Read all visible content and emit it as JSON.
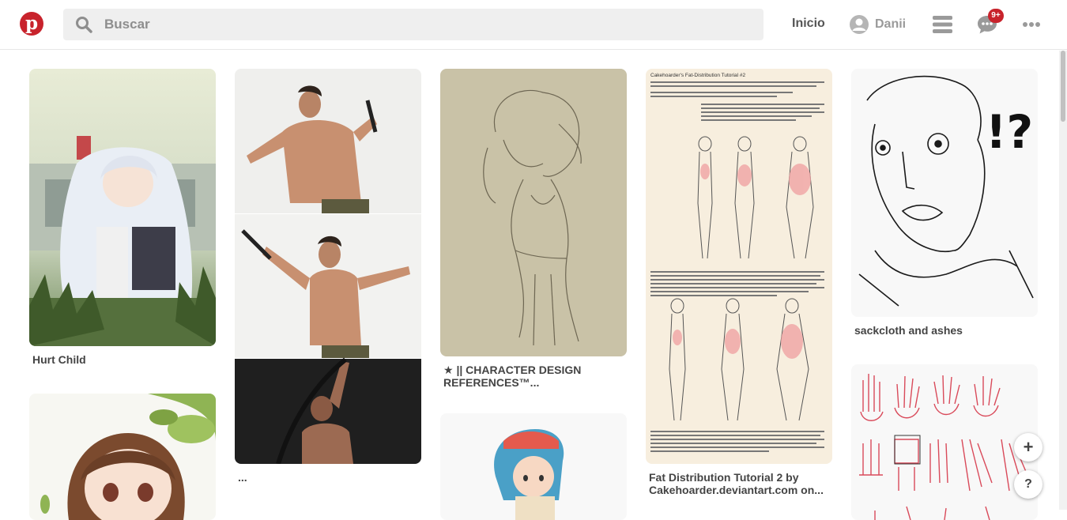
{
  "header": {
    "logo": "p",
    "search_placeholder": "Buscar",
    "home_label": "Inicio",
    "username": "Danii",
    "notification_badge": "9+"
  },
  "icons": {
    "logo": "pinterest-logo",
    "search": "search-icon",
    "avatar": "user-avatar-icon",
    "menu": "hamburger-menu-icon",
    "messages": "message-bubble-icon",
    "more": "more-dots-icon"
  },
  "colors": {
    "brand": "#c8232c",
    "search_bg": "#efefef"
  },
  "pins": [
    {
      "caption": "Hurt Child"
    },
    {
      "caption": "..."
    },
    {
      "caption": "★ || CHARACTER DESIGN REFERENCES™..."
    },
    {
      "caption": "Fat Distribution Tutorial 2 by Cakehoarder.deviantart.com on..."
    },
    {
      "caption": "sackcloth and ashes"
    }
  ],
  "tutorial_pin_text": {
    "title": "Cakehoarder's Fat-Distribution Tutorial #2"
  },
  "floating": {
    "add_label": "+",
    "help_label": "?"
  }
}
